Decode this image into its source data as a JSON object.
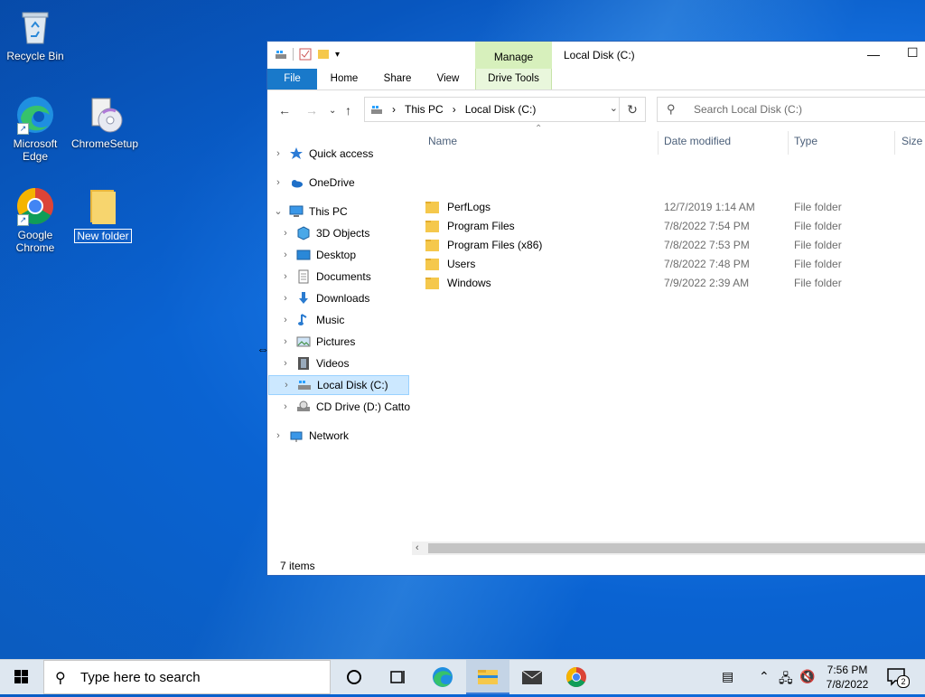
{
  "desktop": {
    "icons": [
      {
        "label": "Recycle Bin"
      },
      {
        "label": "Microsoft Edge"
      },
      {
        "label": "ChromeSetup"
      },
      {
        "label": "Google Chrome"
      },
      {
        "label": "New folder"
      }
    ]
  },
  "explorer": {
    "title": "Local Disk (C:)",
    "contextual_tab": "Manage",
    "ribbon_tabs": [
      "File",
      "Home",
      "Share",
      "View",
      "Drive Tools"
    ],
    "address": {
      "crumbs": [
        "This PC",
        "Local Disk (C:)"
      ]
    },
    "search": {
      "placeholder": "Search Local Disk (C:)"
    },
    "nav": [
      {
        "label": "Quick access"
      },
      {
        "label": "OneDrive"
      },
      {
        "label": "This PC"
      },
      {
        "label": "3D Objects"
      },
      {
        "label": "Desktop"
      },
      {
        "label": "Documents"
      },
      {
        "label": "Downloads"
      },
      {
        "label": "Music"
      },
      {
        "label": "Pictures"
      },
      {
        "label": "Videos"
      },
      {
        "label": "Local Disk (C:)"
      },
      {
        "label": "CD Drive (D:) Catto"
      },
      {
        "label": "Network"
      }
    ],
    "columns": [
      "Name",
      "Date modified",
      "Type",
      "Size"
    ],
    "files": [
      {
        "name": "PerfLogs",
        "date": "12/7/2019 1:14 AM",
        "type": "File folder"
      },
      {
        "name": "Program Files",
        "date": "7/8/2022 7:54 PM",
        "type": "File folder"
      },
      {
        "name": "Program Files (x86)",
        "date": "7/8/2022 7:53 PM",
        "type": "File folder"
      },
      {
        "name": "Users",
        "date": "7/8/2022 7:48 PM",
        "type": "File folder"
      },
      {
        "name": "Windows",
        "date": "7/9/2022 2:39 AM",
        "type": "File folder"
      }
    ],
    "status": "7 items"
  },
  "taskbar": {
    "search_placeholder": "Type here to search",
    "time": "7:56 PM",
    "date": "7/8/2022",
    "notification_count": "2"
  },
  "colors": {
    "file_tab": "#1979ca",
    "manage_tab": "#d7f0bc",
    "selection": "#cce8ff",
    "folder": "#f5c84c"
  }
}
